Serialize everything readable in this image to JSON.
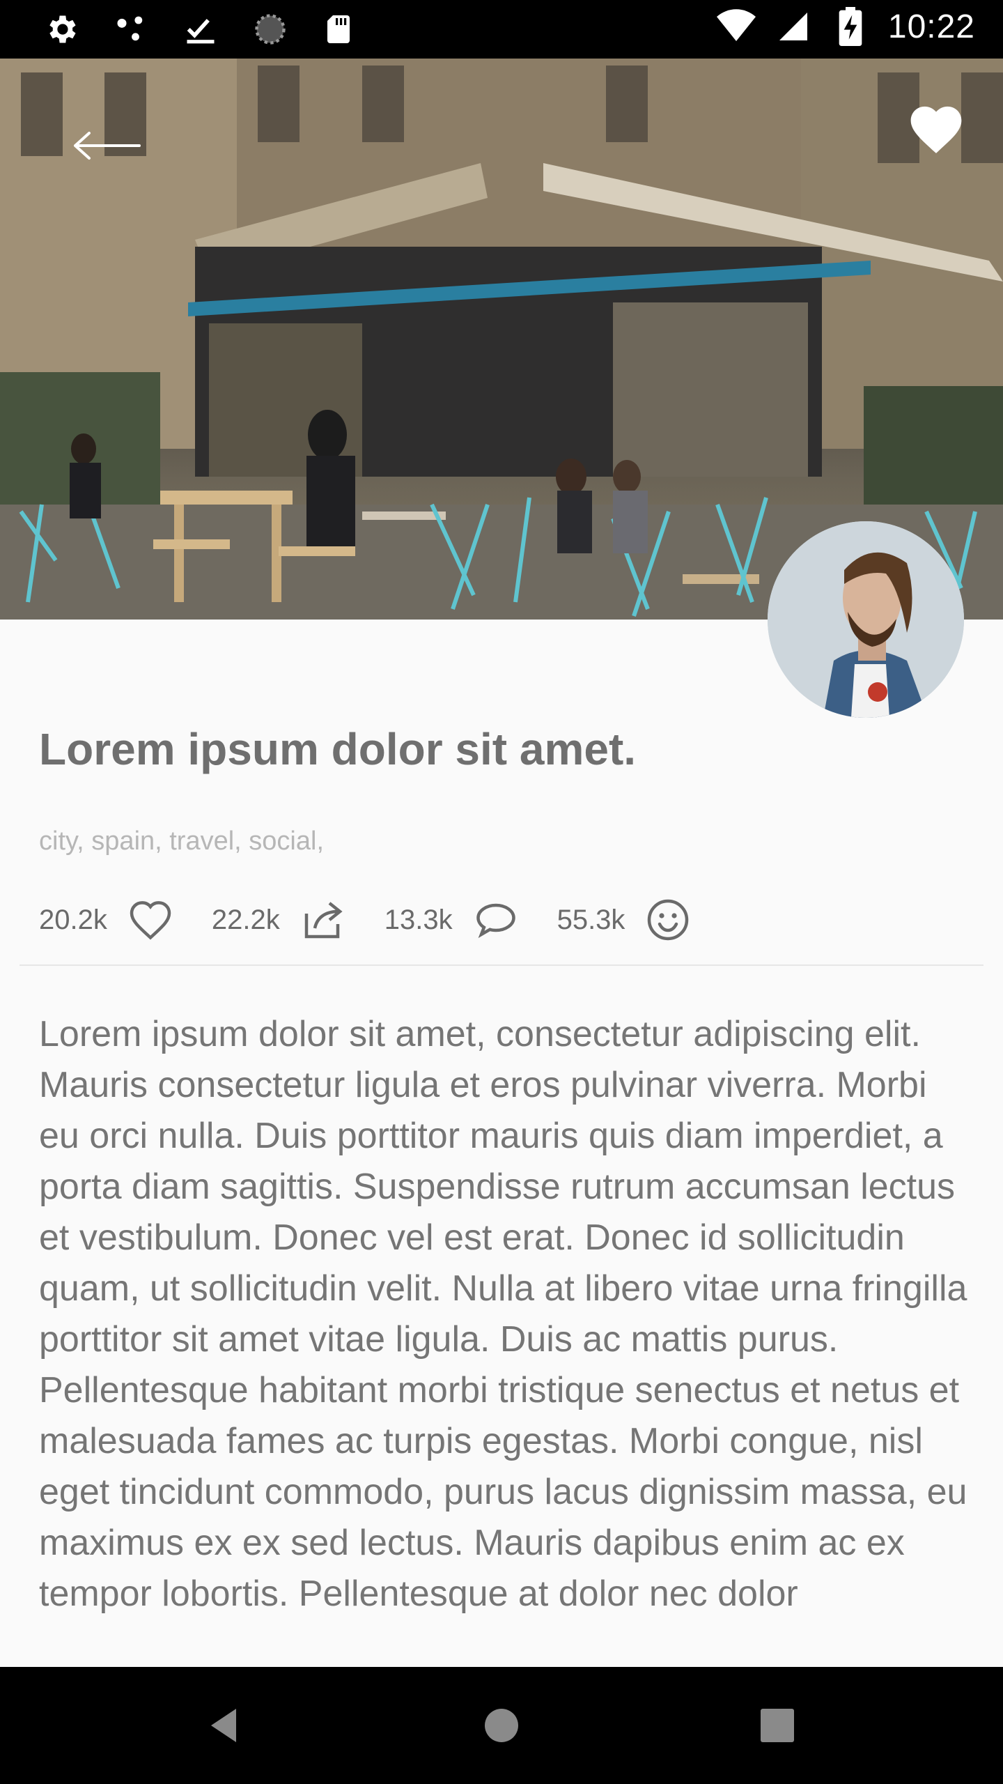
{
  "status_bar": {
    "time": "10:22"
  },
  "hero": {
    "back_icon": "arrow-back-icon",
    "favorite_icon": "heart-filled-icon"
  },
  "post": {
    "title": "Lorem ipsum dolor sit amet.",
    "tags": "city, spain, travel, social,",
    "stats": [
      {
        "count": "20.2k",
        "icon": "heart-outline-icon"
      },
      {
        "count": "22.2k",
        "icon": "share-icon"
      },
      {
        "count": "13.3k",
        "icon": "comment-icon"
      },
      {
        "count": "55.3k",
        "icon": "smiley-icon"
      }
    ],
    "body": "Lorem ipsum dolor sit amet, consectetur adipiscing elit. Mauris consectetur ligula et eros pulvinar viverra. Morbi eu orci nulla. Duis porttitor mauris quis diam imperdiet, a porta diam sagittis. Suspendisse rutrum accumsan lectus et vestibulum. Donec vel est erat. Donec id sollicitudin quam, ut sollicitudin velit. Nulla at libero vitae urna fringilla porttitor sit amet vitae ligula. Duis ac mattis purus. Pellentesque habitant morbi tristique senectus et netus et malesuada fames ac turpis egestas. Morbi congue, nisl eget tincidunt commodo, purus lacus dignissim massa, eu maximus ex ex sed lectus. Mauris dapibus enim ac ex tempor lobortis. Pellentesque at dolor nec dolor"
  },
  "colors": {
    "background": "#fafafa",
    "title": "#6f6f6f",
    "tags": "#b6b6b6",
    "body": "#757575"
  }
}
